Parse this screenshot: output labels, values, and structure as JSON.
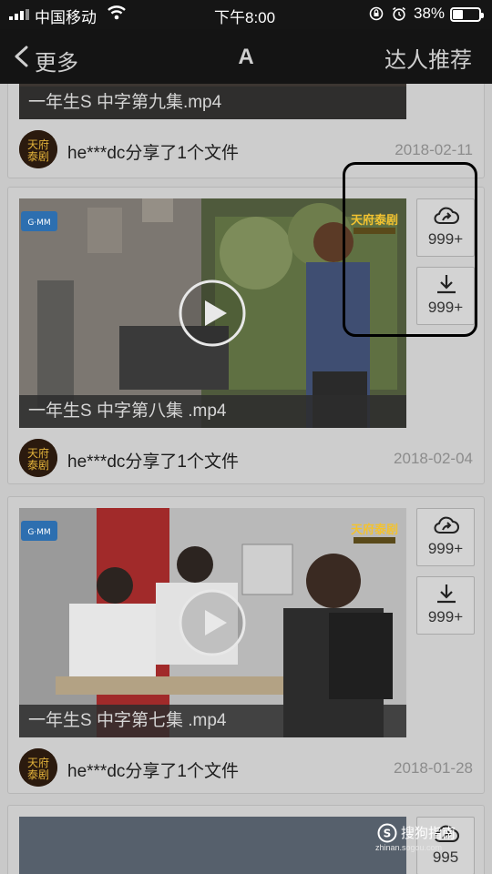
{
  "status_bar": {
    "carrier": "中国移动",
    "time": "下午8:00",
    "battery": "38%",
    "battery_level": 0.38,
    "icons": [
      "signal-icon",
      "wifi-icon",
      "orientation-lock-icon",
      "alarm-icon",
      "battery-icon"
    ]
  },
  "nav": {
    "back_label": "更多",
    "title": "A",
    "right_label": "达人推荐"
  },
  "feed": {
    "items": [
      {
        "caption": "一年生S 中字第九集.mp4",
        "user_share": "he***dc分享了1个文件",
        "date": "2018-02-11"
      },
      {
        "caption": "一年生S 中字第八集 .mp4",
        "user_share": "he***dc分享了1个文件",
        "date": "2018-02-04",
        "share_count": "999+",
        "download_count": "999+"
      },
      {
        "caption": "一年生S 中字第七集 .mp4",
        "user_share": "he***dc分享了1个文件",
        "date": "2018-01-28",
        "share_count": "999+",
        "download_count": "999+"
      },
      {
        "share_count": "995"
      }
    ]
  },
  "watermark": {
    "text": "搜狗指南",
    "url": "zhinan.sogou.com"
  },
  "colors": {
    "bar_background": "#141414",
    "page_background": "#c9c9c9",
    "card_background": "#cdcdcd",
    "highlight_border": "#000000"
  }
}
